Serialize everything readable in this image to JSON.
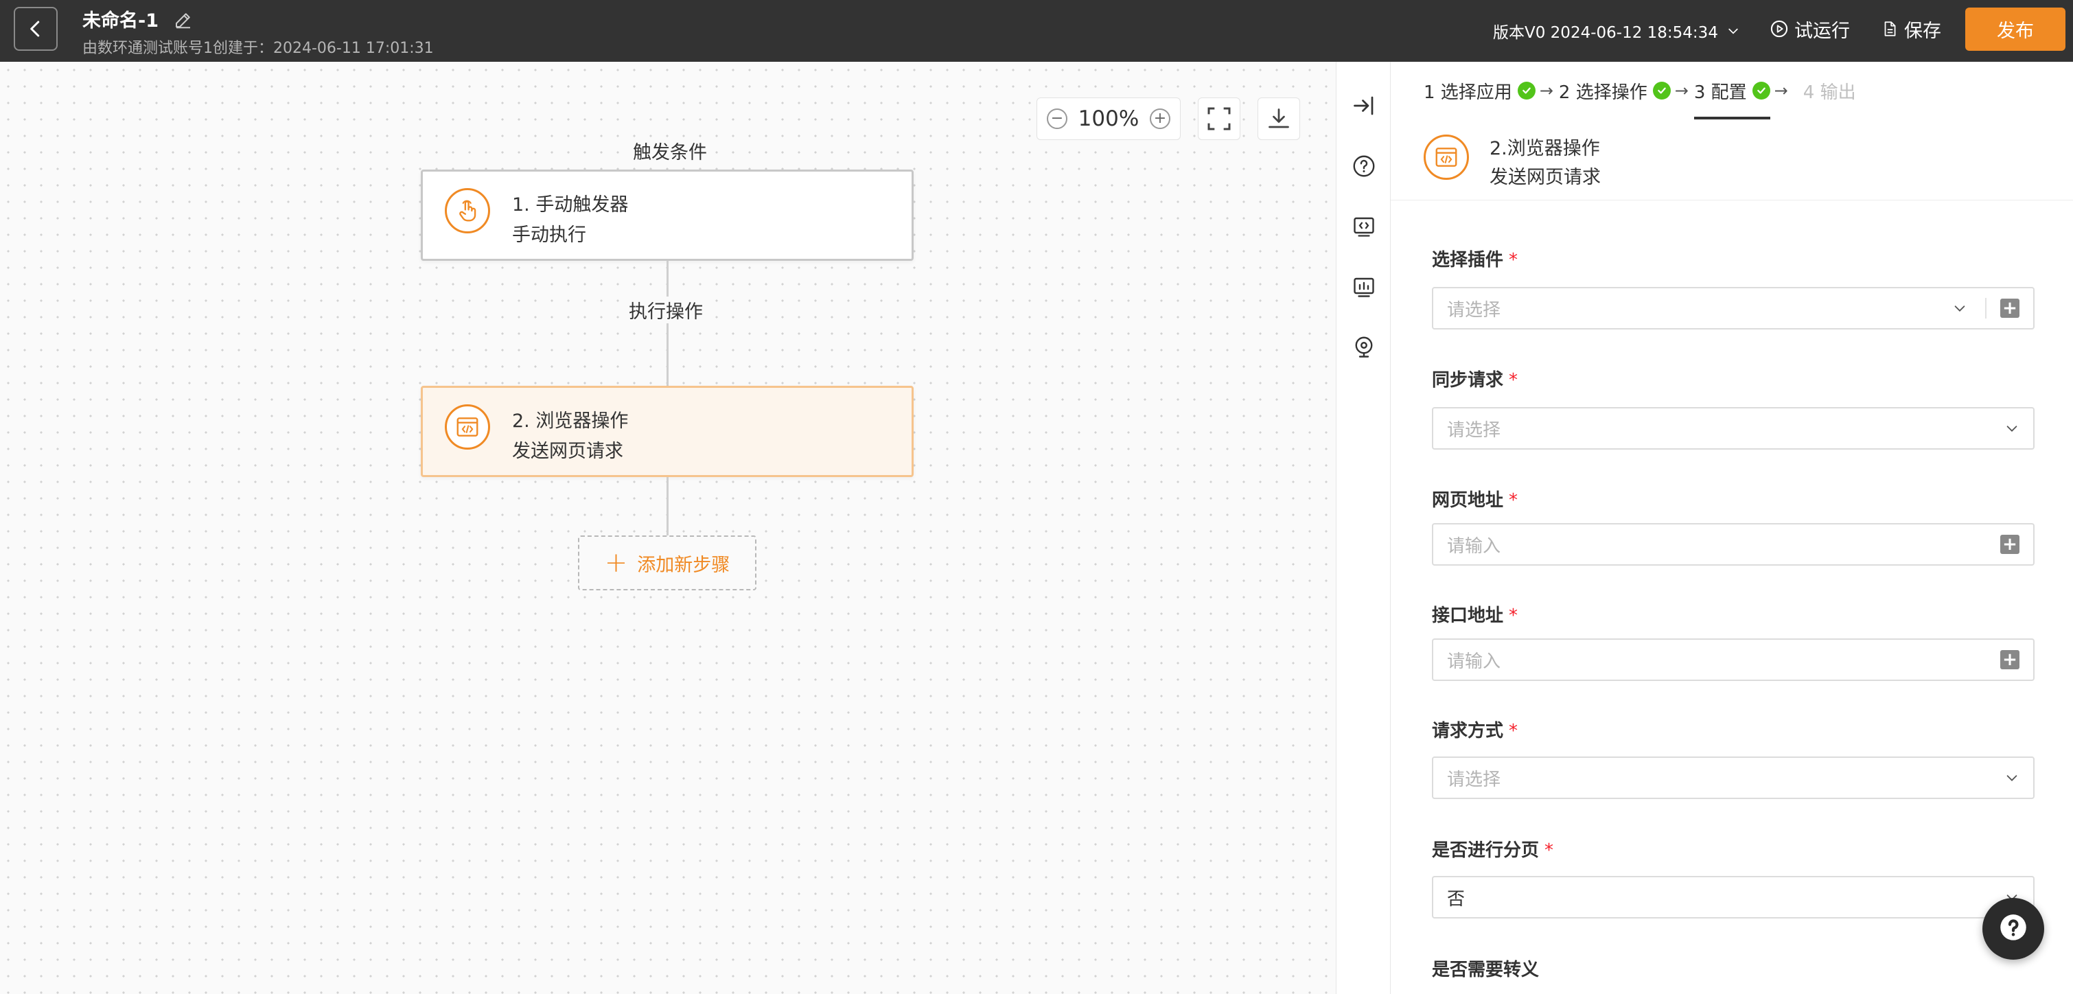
{
  "header": {
    "title": "未命名-1",
    "subtitle": "由数环通测试账号1创建于：2024-06-11 17:01:31",
    "version": "版本V0 2024-06-12 18:54:34",
    "test_run_label": "试运行",
    "save_label": "保存",
    "publish_label": "发布"
  },
  "canvas": {
    "zoom": "100%",
    "trigger_label": "触发条件",
    "action_label": "执行操作",
    "nodes": [
      {
        "title": "1. 手动触发器",
        "subtitle": "手动执行"
      },
      {
        "title": "2. 浏览器操作",
        "subtitle": "发送网页请求"
      }
    ],
    "add_step_label": "添加新步骤"
  },
  "panel": {
    "steps": [
      {
        "label": "1 选择应用",
        "status": "done"
      },
      {
        "label": "2 选择操作",
        "status": "done"
      },
      {
        "label": "3 配置",
        "status": "current"
      },
      {
        "label": "4 输出",
        "status": "pending"
      }
    ],
    "node": {
      "title": "2.浏览器操作",
      "subtitle": "发送网页请求"
    },
    "fields": [
      {
        "label": "选择插件",
        "placeholder": "请选择",
        "value": ""
      },
      {
        "label": "同步请求",
        "placeholder": "请选择",
        "value": ""
      },
      {
        "label": "网页地址",
        "placeholder": "请输入",
        "value": ""
      },
      {
        "label": "接口地址",
        "placeholder": "请输入",
        "value": ""
      },
      {
        "label": "请求方式",
        "placeholder": "请选择",
        "value": ""
      },
      {
        "label": "是否进行分页",
        "placeholder": "",
        "value": "否"
      },
      {
        "label": "是否需要转义",
        "placeholder": "",
        "value": ""
      }
    ]
  },
  "colors": {
    "accent": "#f08a24",
    "header_bg": "#333333",
    "success": "#52c41a",
    "required": "#f5222d"
  }
}
